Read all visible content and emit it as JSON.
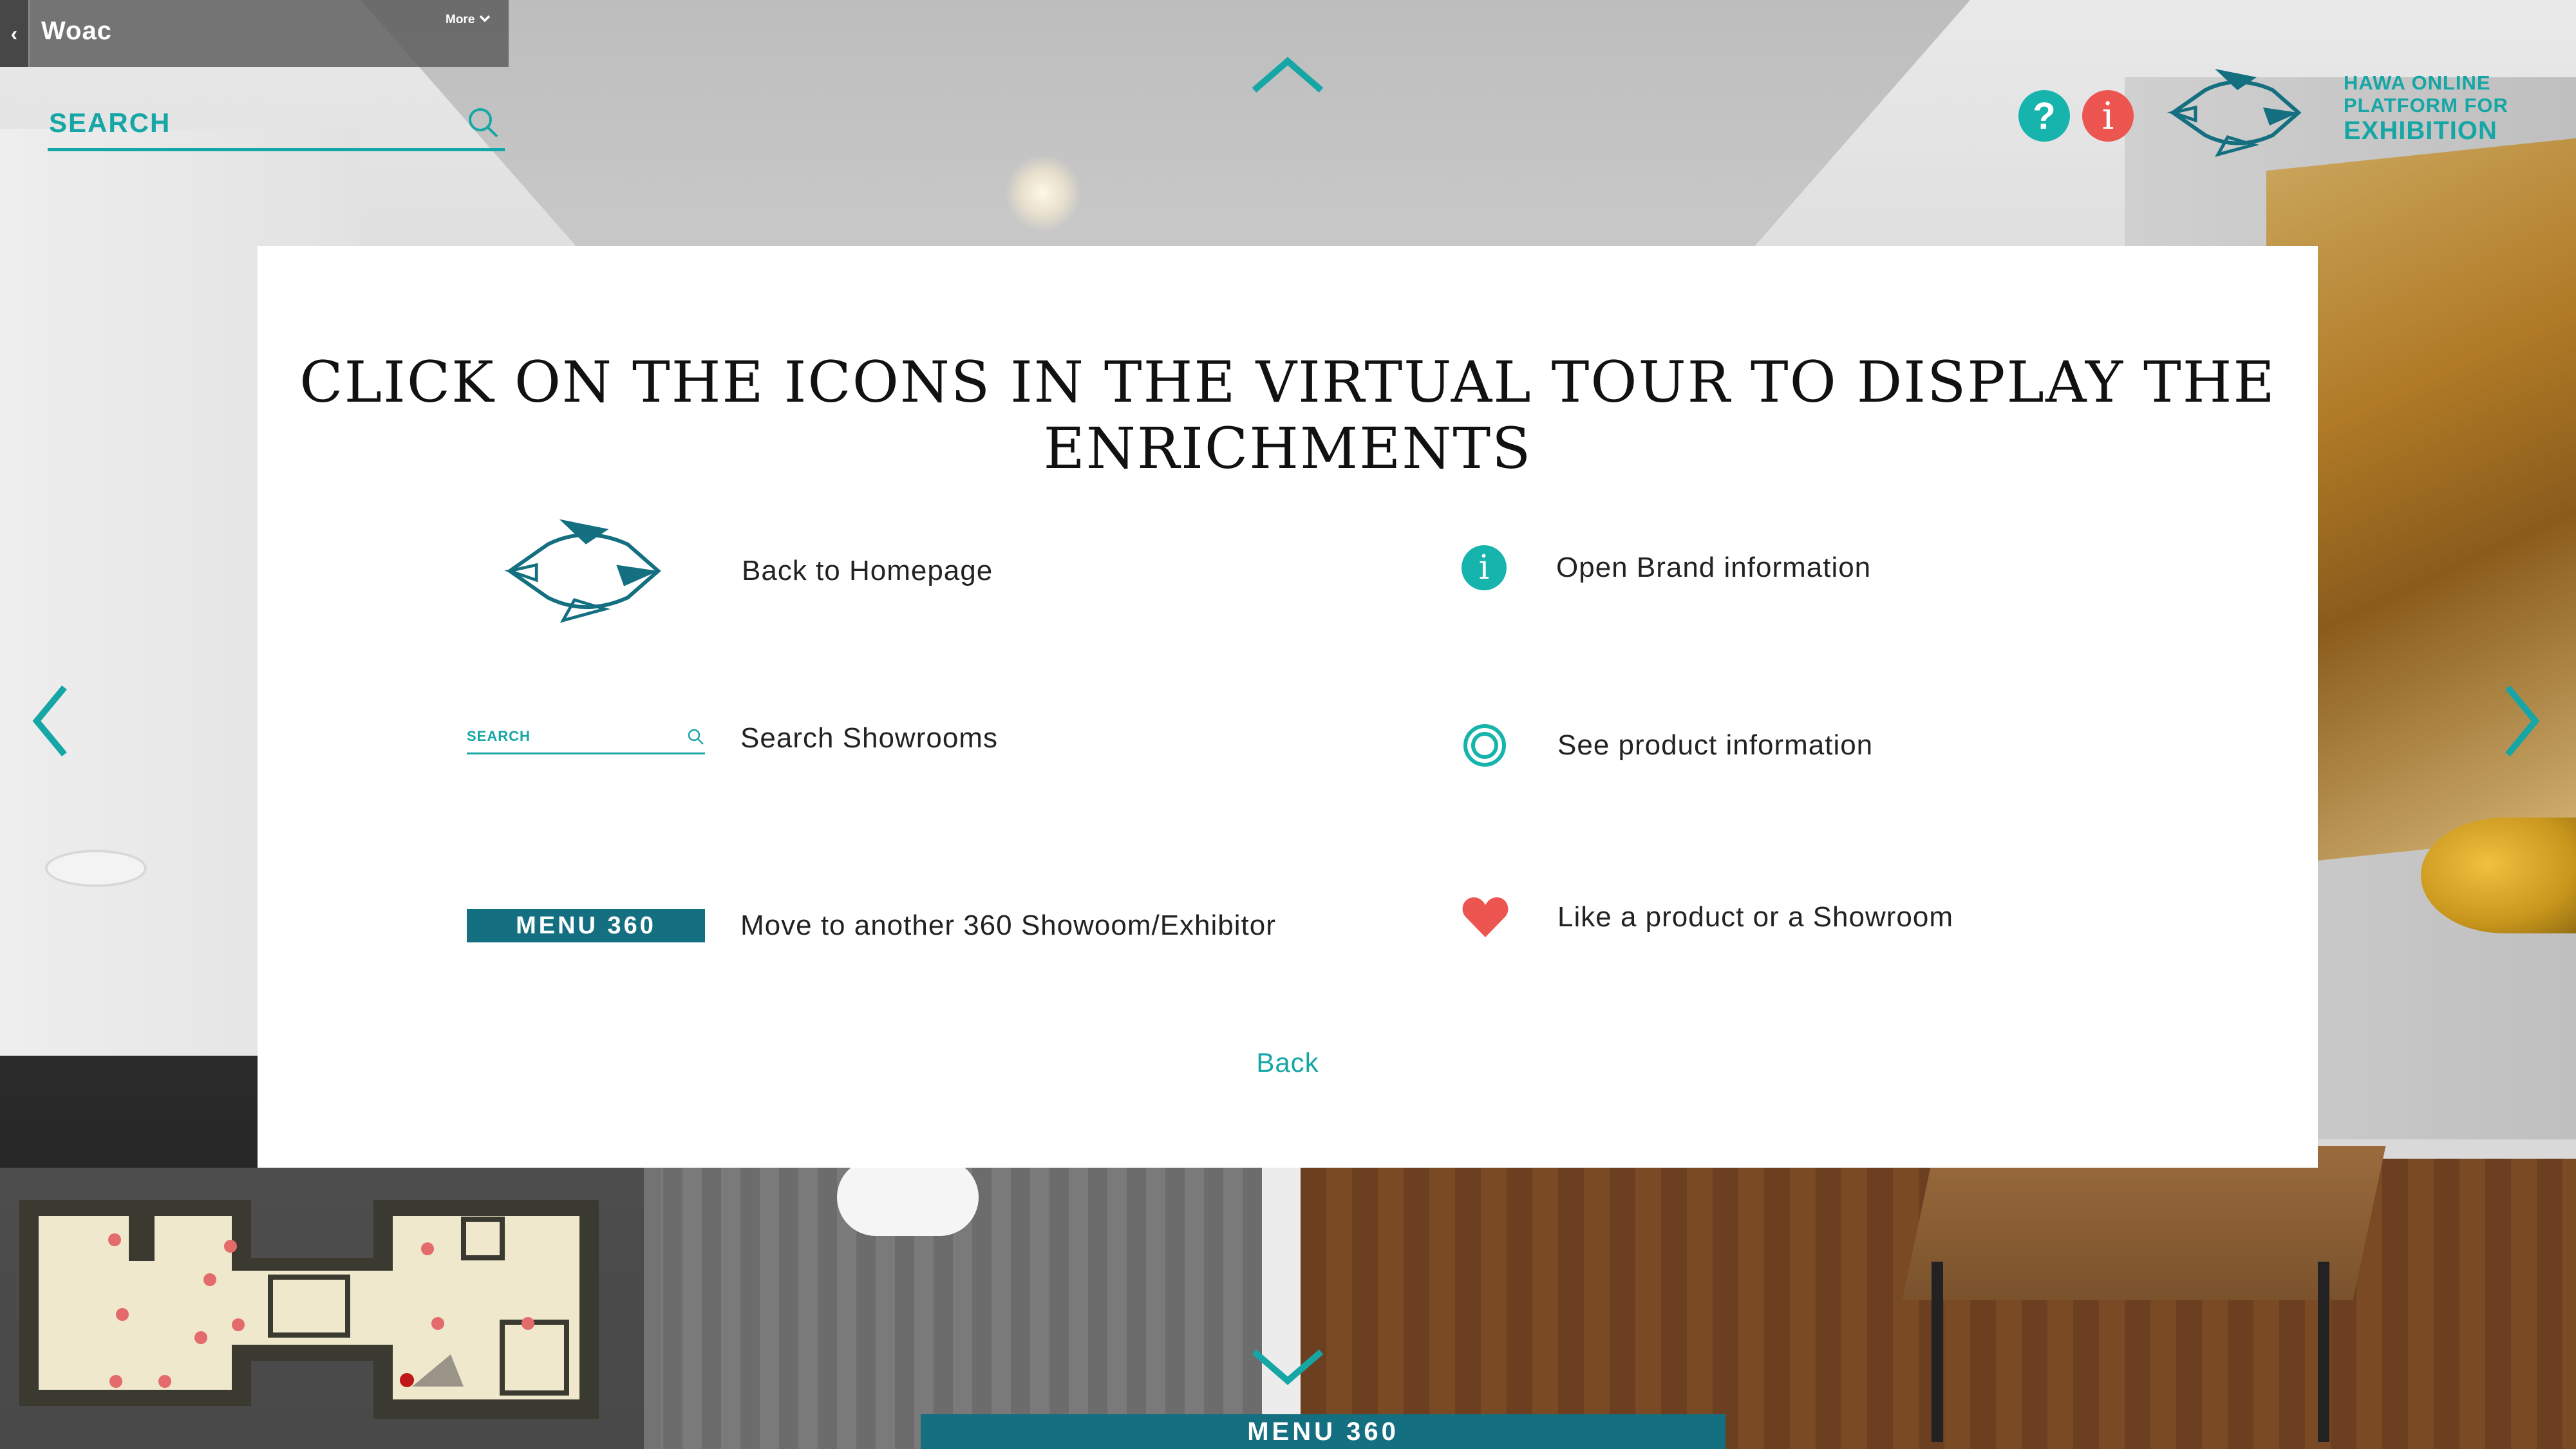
{
  "topbar": {
    "back_glyph": "‹",
    "title": "Woac",
    "more_label": "More"
  },
  "search": {
    "placeholder": "SEARCH"
  },
  "brand": {
    "line1": "HAWA ONLINE",
    "line2": "PLATFORM FOR",
    "line3": "EXHIBITION"
  },
  "buttons": {
    "help_glyph": "?",
    "info_glyph": "i"
  },
  "modal": {
    "title": "CLICK ON THE ICONS IN THE VIRTUAL TOUR TO DISPLAY THE ENRICHMENTS",
    "items": [
      {
        "icon": "hawa-logo-icon",
        "label": "Back to Homepage"
      },
      {
        "icon": "search-field-icon",
        "label": "Search Showrooms",
        "sample": "SEARCH"
      },
      {
        "icon": "menu-360-button-icon",
        "label": "Move to another 360 Showoom/Exhibitor",
        "sample": "MENU 360"
      },
      {
        "icon": "info-icon",
        "label": "Open Brand information",
        "glyph": "i"
      },
      {
        "icon": "ring-icon",
        "label": "See product information"
      },
      {
        "icon": "heart-icon",
        "label": "Like a product or a Showroom"
      }
    ],
    "back_label": "Back"
  },
  "bottom": {
    "menu360_label": "MENU 360"
  },
  "colors": {
    "teal": "#16a6a6",
    "dark_teal": "#146f80",
    "red": "#ec5550"
  }
}
